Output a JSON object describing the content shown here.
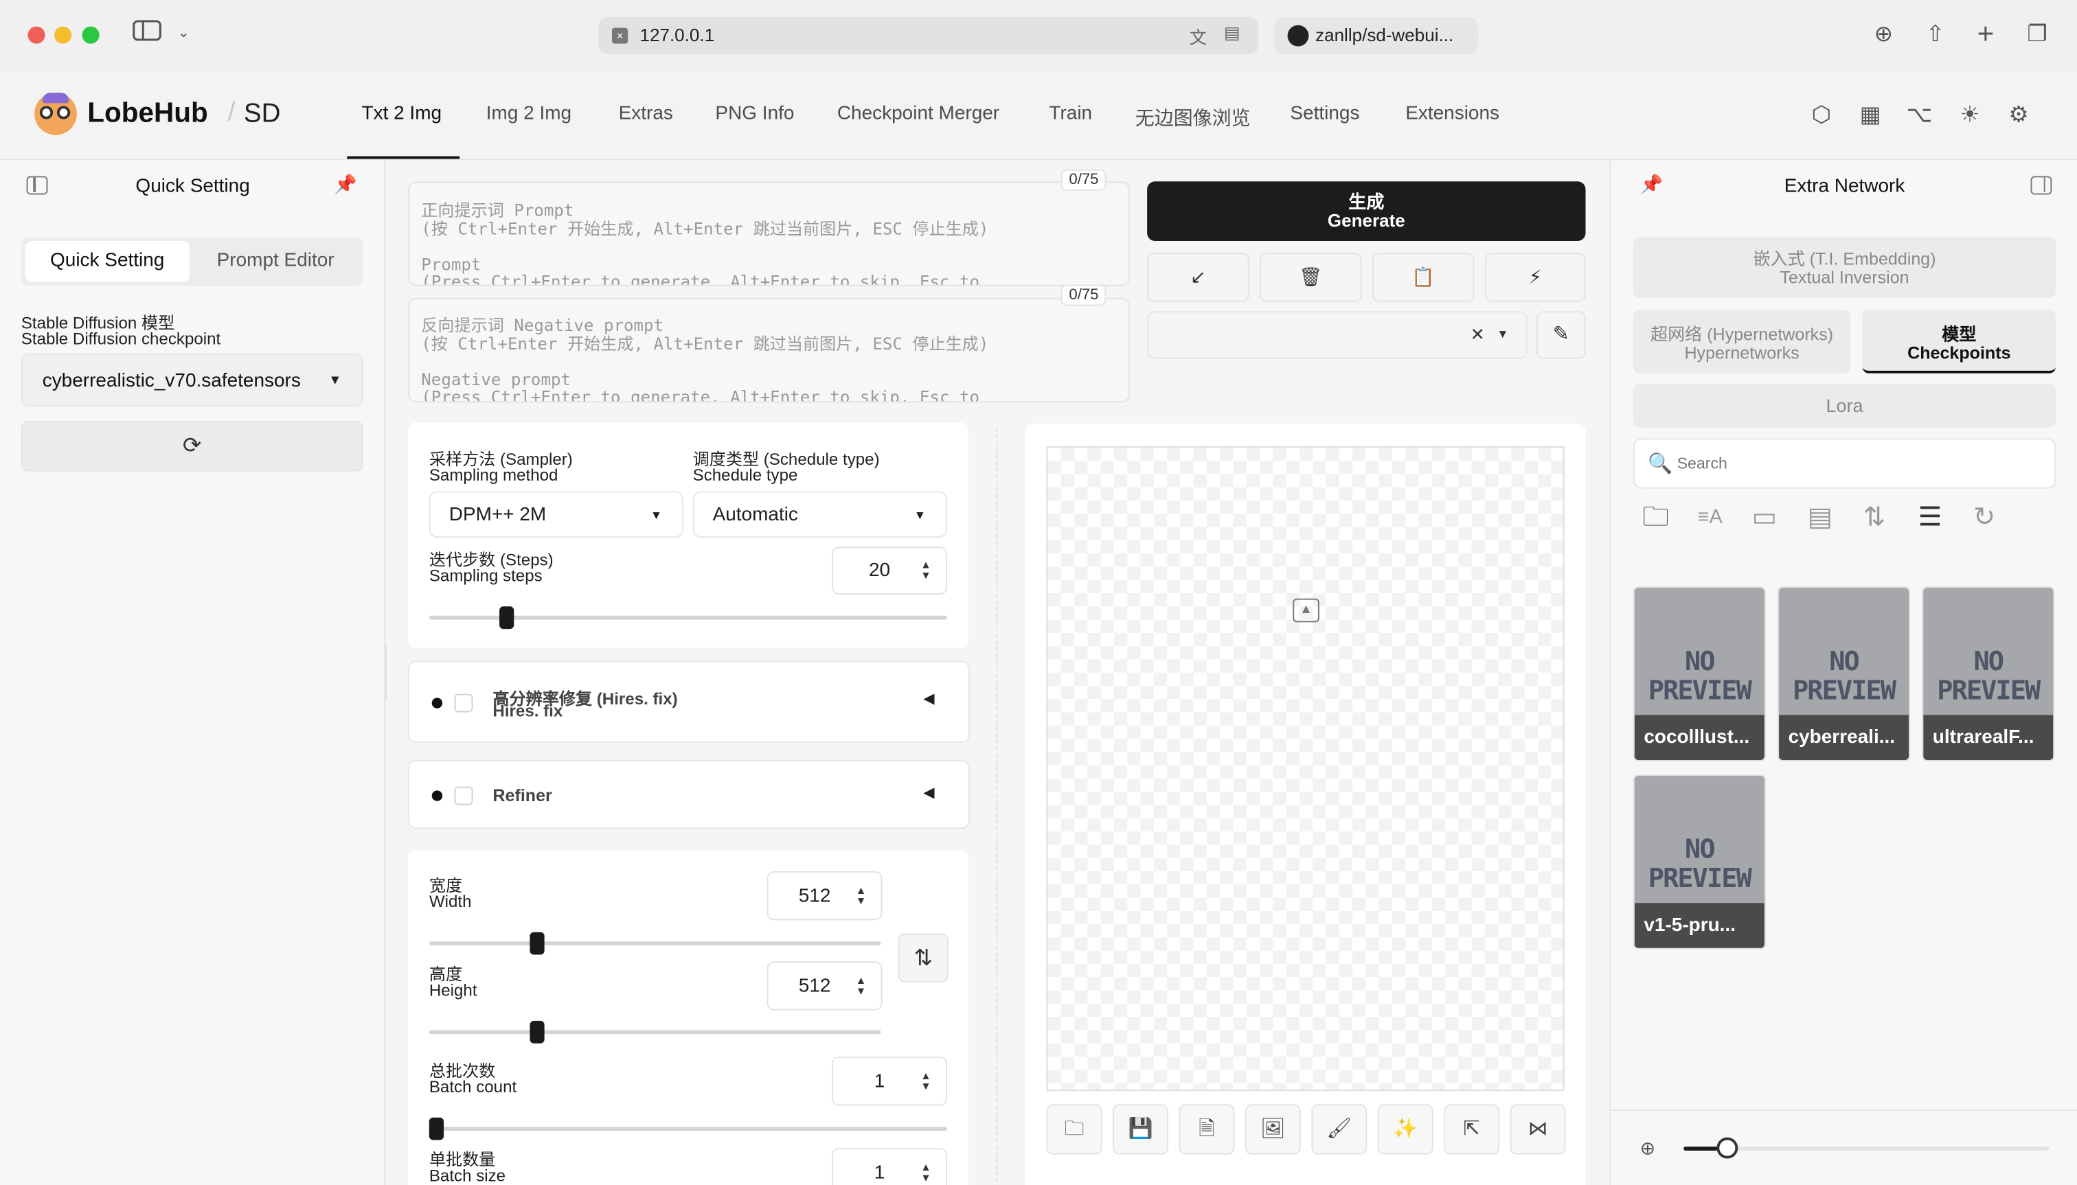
{
  "browser": {
    "url": "127.0.0.1",
    "second_tab": "zanllp/sd-webui..."
  },
  "header": {
    "brand": "LobeHub",
    "brand_suffix": "SD",
    "nav": [
      "Txt 2 Img",
      "Img 2 Img",
      "Extras",
      "PNG Info",
      "Checkpoint Merger",
      "Train",
      "无边图像浏览",
      "Settings",
      "Extensions"
    ],
    "active_nav": "Txt 2 Img"
  },
  "left": {
    "title": "Quick Setting",
    "tabs": [
      "Quick Setting",
      "Prompt Editor"
    ],
    "model_label_cn": "Stable Diffusion 模型",
    "model_label_en": "Stable Diffusion checkpoint",
    "model_value": "cyberrealistic_v70.safetensors"
  },
  "prompt": {
    "placeholder": "正向提示词 Prompt\n(按 Ctrl+Enter 开始生成, Alt+Enter 跳过当前图片, ESC 停止生成)\n\nPrompt\n(Press Ctrl+Enter to generate, Alt+Enter to skip, Esc to",
    "counter": "0/75"
  },
  "negative": {
    "placeholder": "反向提示词 Negative prompt\n(按 Ctrl+Enter 开始生成, Alt+Enter 跳过当前图片, ESC 停止生成)\n\nNegative prompt\n(Press Ctrl+Enter to generate, Alt+Enter to skip, Esc to",
    "counter": "0/75"
  },
  "generate": {
    "label_cn": "生成",
    "label_en": "Generate"
  },
  "sampler": {
    "label_cn": "采样方法 (Sampler)",
    "label_en": "Sampling method",
    "value": "DPM++ 2M"
  },
  "schedule": {
    "label_cn": "调度类型 (Schedule type)",
    "label_en": "Schedule type",
    "value": "Automatic"
  },
  "steps": {
    "label_cn": "迭代步数 (Steps)",
    "label_en": "Sampling steps",
    "value": "20",
    "level": 0.14
  },
  "hires": {
    "label_cn": "高分辨率修复 (Hires. fix)",
    "label_en": "Hires. fix"
  },
  "refiner": {
    "label": "Refiner"
  },
  "width": {
    "label_cn": "宽度",
    "label_en": "Width",
    "value": "512",
    "level": 0.23
  },
  "height": {
    "label_cn": "高度",
    "label_en": "Height",
    "value": "512",
    "level": 0.23
  },
  "batch_count": {
    "label_cn": "总批次数",
    "label_en": "Batch count",
    "value": "1",
    "level": 0.0
  },
  "batch_size": {
    "label_cn": "单批数量",
    "label_en": "Batch size",
    "value": "1"
  },
  "right": {
    "title": "Extra Network",
    "tabs": [
      {
        "cn": "嵌入式 (T.I. Embedding)",
        "en": "Textual Inversion"
      },
      {
        "cn": "超网络 (Hypernetworks)",
        "en": "Hypernetworks"
      },
      {
        "cn": "模型",
        "en": "Checkpoints"
      },
      {
        "cn": "",
        "en": "Lora"
      }
    ],
    "active_tab": "Checkpoints",
    "search_placeholder": "Search",
    "thumb_text": "NO\nPREVIEW",
    "models": [
      "cocolllust...",
      "cyberreali...",
      "ultrarealF...",
      "v1-5-pru..."
    ],
    "zoom_level": 0.12
  },
  "colors": {
    "accent": "#1c1c1c",
    "generate_bg": "#1c1c1c",
    "thumb_bg": "#a5a7ab"
  }
}
